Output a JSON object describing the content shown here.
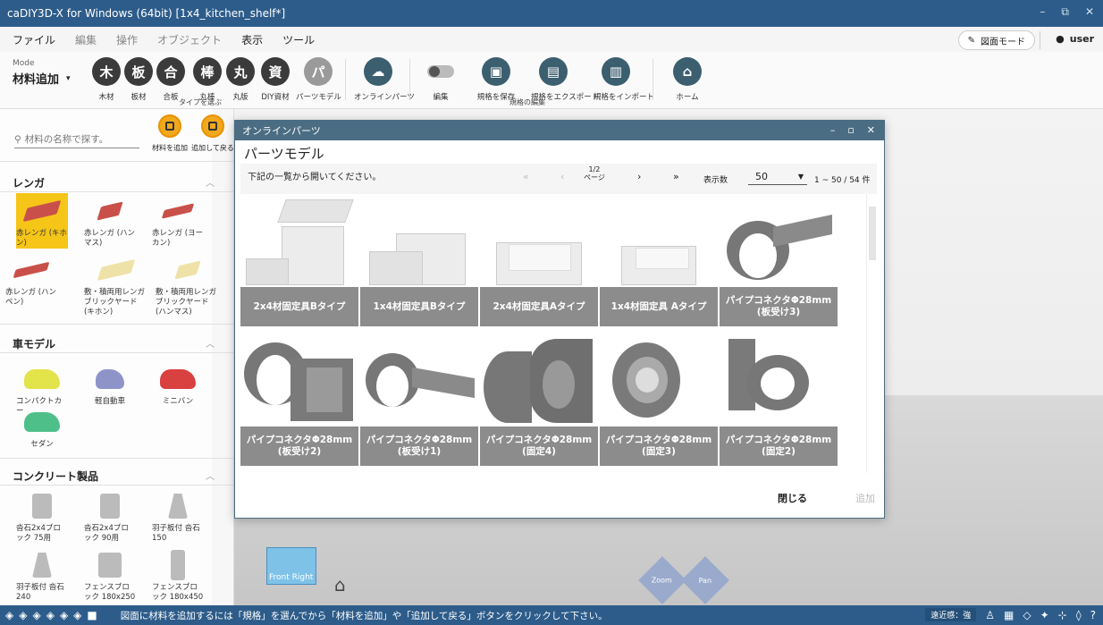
{
  "window": {
    "title": "caDIY3D-X for Windows (64bit) [1x4_kitchen_shelf*]",
    "controls": [
      "–",
      "⧉",
      "✕"
    ]
  },
  "menu": [
    "ファイル",
    "編集",
    "操作",
    "オブジェクト",
    "表示",
    "ツール"
  ],
  "header_right": {
    "draw_mode": "図面モード",
    "user": "user"
  },
  "ribbon": {
    "mode_label": "Mode",
    "mode_value": "材料追加",
    "material_buttons": [
      {
        "icon": "木",
        "label": "木材"
      },
      {
        "icon": "板",
        "label": "板材"
      },
      {
        "icon": "合",
        "label": "合板"
      },
      {
        "icon": "棒",
        "label": "丸棒"
      },
      {
        "icon": "丸",
        "label": "丸版"
      },
      {
        "icon": "資",
        "label": "DIY資材"
      },
      {
        "icon": "パ",
        "label": "パーツモデル"
      }
    ],
    "type_caption": "タイプを選ぶ",
    "online_parts": "オンラインパーツ",
    "edit": "編集",
    "spec_buttons": [
      "規格を保存",
      "規格をエクスポート",
      "規格をインポート"
    ],
    "spec_caption": "規格の編集",
    "home": "ホーム"
  },
  "left_panel": {
    "search_placeholder": "材料の名称で探す。",
    "add_material": "材料を追加",
    "add_and_back": "追加して戻る",
    "sections": [
      {
        "title": "レンガ",
        "items": [
          "赤レンガ (キホン)",
          "赤レンガ (ハンマス)",
          "赤レンガ (ヨーカン)",
          "赤レンガ (ハンペン)",
          "敷・積両用レンガ ブリックヤード (キホン)",
          "敷・積両用レンガ ブリックヤード (ハンマス)"
        ]
      },
      {
        "title": "車モデル",
        "items": [
          "コンパクトカー",
          "軽自動車",
          "ミニバン",
          "セダン"
        ]
      },
      {
        "title": "コンクリート製品",
        "items": [
          "沓石2x4ブロック 75用",
          "沓石2x4ブロック 90用",
          "羽子板付 沓石 150",
          "羽子板付 沓石 240",
          "フェンスブロック 180x250",
          "フェンスブロック 180x450"
        ]
      }
    ]
  },
  "viewport": {
    "cube_front": "Front",
    "cube_right": "Right",
    "zoom": "Zoom",
    "pan": "Pan"
  },
  "dialog": {
    "title": "オンラインパーツ",
    "heading": "パーツモデル",
    "instruction": "下記の一覧から開いてください。",
    "page": "1/2",
    "page_unit": "ページ",
    "per_page_label": "表示数",
    "per_page": "50",
    "range": "1 ~ 50 / 54 件",
    "parts": [
      "2x4材固定具Bタイプ",
      "1x4材固定具Bタイプ",
      "2x4材固定具Aタイプ",
      "1x4材固定具 Aタイプ",
      "パイプコネクタΦ28mm (板受け3)",
      "パイプコネクタΦ28mm (板受け2)",
      "パイプコネクタΦ28mm (板受け1)",
      "パイプコネクタΦ28mm (固定4)",
      "パイプコネクタΦ28mm (固定3)",
      "パイプコネクタΦ28mm (固定2)"
    ],
    "close": "閉じる",
    "add": "追加"
  },
  "status": {
    "message": "図面に材料を追加するには「規格」を選んでから「材料を追加」や「追加して戻る」ボタンをクリックして下さい。",
    "distance": "遠近感：強"
  },
  "colors": {
    "titlebar": "#2d5c8a",
    "dialog_title": "#4b6d83",
    "accent_orange": "#f2a81d",
    "selected": "#f5c518"
  }
}
